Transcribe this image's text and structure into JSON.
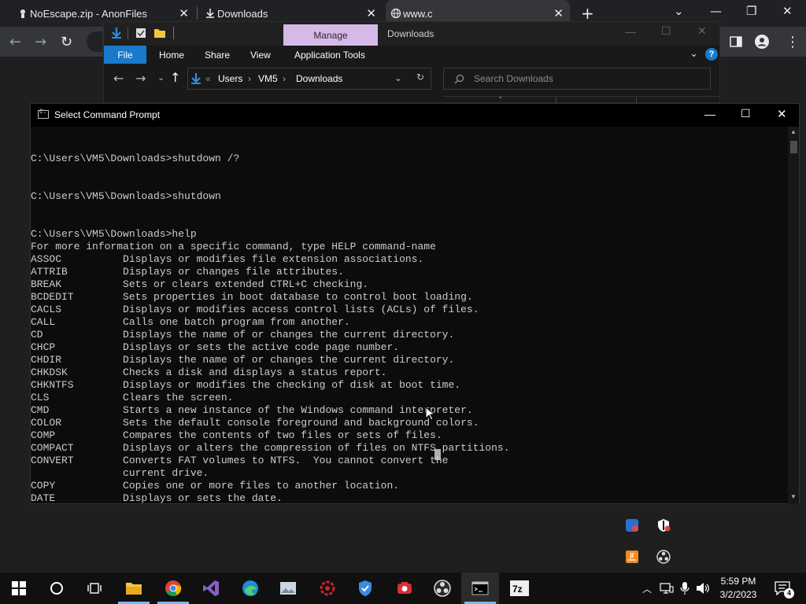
{
  "browser": {
    "tabs": [
      {
        "label": "NoEscape.zip - AnonFiles"
      },
      {
        "label": "Downloads"
      },
      {
        "label": "www.c"
      }
    ],
    "new_tab": "+",
    "window_controls": {
      "chevron": "⌄",
      "minimize": "—",
      "restore": "❐",
      "close": "✕"
    }
  },
  "explorer": {
    "title_tab": "Manage",
    "title": "Downloads",
    "ribbon": {
      "file": "File",
      "home": "Home",
      "share": "Share",
      "view": "View",
      "app_tools": "Application Tools"
    },
    "breadcrumb": [
      "Users",
      "VM5",
      "Downloads"
    ],
    "search_placeholder": "Search Downloads"
  },
  "cmd": {
    "title": "Select Command Prompt",
    "lines": [
      "",
      "C:\\Users\\VM5\\Downloads>shutdown /?",
      "",
      "",
      "C:\\Users\\VM5\\Downloads>shutdown",
      "",
      "",
      "C:\\Users\\VM5\\Downloads>help",
      "For more information on a specific command, type HELP command-name",
      "ASSOC          Displays or modifies file extension associations.",
      "ATTRIB         Displays or changes file attributes.",
      "BREAK          Sets or clears extended CTRL+C checking.",
      "BCDEDIT        Sets properties in boot database to control boot loading.",
      "CACLS          Displays or modifies access control lists (ACLs) of files.",
      "CALL           Calls one batch program from another.",
      "CD             Displays the name of or changes the current directory.",
      "CHCP           Displays or sets the active code page number.",
      "CHDIR          Displays the name of or changes the current directory.",
      "CHKDSK         Checks a disk and displays a status report.",
      "CHKNTFS        Displays or modifies the checking of disk at boot time.",
      "CLS            Clears the screen.",
      "CMD            Starts a new instance of the Windows command interpreter.",
      "COLOR          Sets the default console foreground and background colors.",
      "COMP           Compares the contents of two files or sets of files.",
      "COMPACT        Displays or alters the compression of files on NTFS partitions.",
      "CONVERT        Converts FAT volumes to NTFS.  You cannot convert the",
      "               current drive.",
      "COPY           Copies one or more files to another location.",
      "DATE           Displays or sets the date."
    ]
  },
  "taskbar": {
    "time": "5:59 PM",
    "date": "3/2/2023",
    "notifications": "4"
  },
  "colors": {
    "accent": "#1979ca",
    "manage_tab": "#d5b9e8",
    "console_text": "#cccccc"
  }
}
